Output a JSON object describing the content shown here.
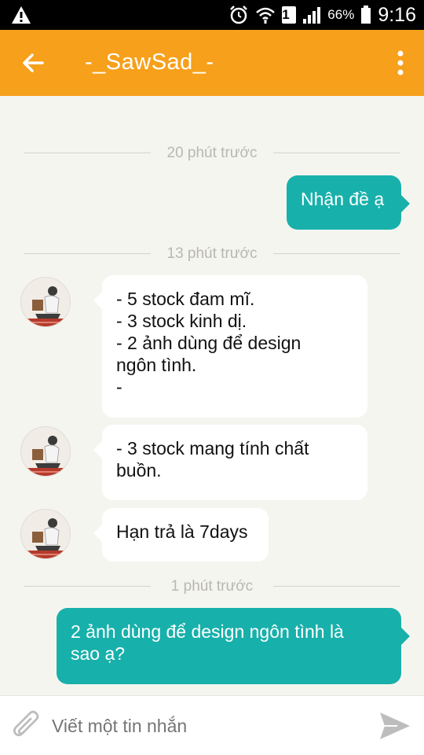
{
  "status_bar": {
    "battery": "66%",
    "time": "9:16",
    "sim_slot": "1",
    "icons": [
      "warning-icon",
      "alarm-icon",
      "wifi-icon",
      "sim-icon",
      "signal-icon",
      "battery-icon"
    ]
  },
  "app_bar": {
    "title": "-_SawSad_-",
    "color": "#f7a01b"
  },
  "messages": {
    "divider_1": "20 phút trước",
    "out_1": "Nhận đề ạ",
    "divider_2": "13 phút trước",
    "in_1": [
      "- 5 stock đam mĩ.",
      "- 3 stock kinh dị.",
      "- 2 ảnh dùng để design",
      "ngôn tình.",
      "-"
    ],
    "in_2": [
      "- 3 stock mang tính chất",
      "buồn."
    ],
    "in_3": "Hạn trả là 7days",
    "divider_3": "1 phút trước",
    "out_2": [
      "2 ảnh dùng để design ngôn tình là",
      "sao ạ?"
    ]
  },
  "input": {
    "placeholder": "Viết một tin nhắn"
  },
  "colors": {
    "outgoing_bubble": "#18b0ab",
    "incoming_bubble": "#ffffff",
    "background": "#f5f5ef"
  }
}
